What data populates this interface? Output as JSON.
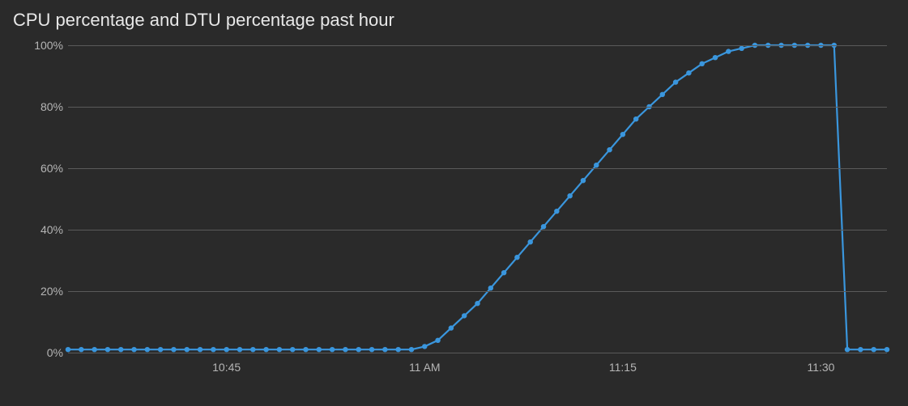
{
  "title": "CPU percentage and DTU percentage past hour",
  "colors": {
    "series": "#3a96dd",
    "grid": "#5a5a5a",
    "text": "#b5b5b5",
    "title": "#e8e8e8",
    "bg": "#2a2a2a"
  },
  "y_ticks": [
    {
      "label": "100%",
      "value": 100
    },
    {
      "label": "80%",
      "value": 80
    },
    {
      "label": "60%",
      "value": 60
    },
    {
      "label": "40%",
      "value": 40
    },
    {
      "label": "20%",
      "value": 20
    },
    {
      "label": "0%",
      "value": 0
    }
  ],
  "x_ticks": [
    {
      "label": "10:45",
      "minute": 45
    },
    {
      "label": "11 AM",
      "minute": 60
    },
    {
      "label": "11:15",
      "minute": 75
    },
    {
      "label": "11:30",
      "minute": 90
    }
  ],
  "chart_data": {
    "type": "line",
    "title": "CPU percentage and DTU percentage past hour",
    "xlabel": "",
    "ylabel": "",
    "ylim": [
      0,
      100
    ],
    "xrange_minutes": [
      33,
      95
    ],
    "x": [
      33,
      34,
      35,
      36,
      37,
      38,
      39,
      40,
      41,
      42,
      43,
      44,
      45,
      46,
      47,
      48,
      49,
      50,
      51,
      52,
      53,
      54,
      55,
      56,
      57,
      58,
      59,
      60,
      61,
      62,
      63,
      64,
      65,
      66,
      67,
      68,
      69,
      70,
      71,
      72,
      73,
      74,
      75,
      76,
      77,
      78,
      79,
      80,
      81,
      82,
      83,
      84,
      85,
      86,
      87,
      88,
      89,
      90,
      91,
      92,
      93,
      94,
      95
    ],
    "series": [
      {
        "name": "CPU / DTU percentage",
        "values": [
          1,
          1,
          1,
          1,
          1,
          1,
          1,
          1,
          1,
          1,
          1,
          1,
          1,
          1,
          1,
          1,
          1,
          1,
          1,
          1,
          1,
          1,
          1,
          1,
          1,
          1,
          1,
          2,
          4,
          8,
          12,
          16,
          21,
          26,
          31,
          36,
          41,
          46,
          51,
          56,
          61,
          66,
          71,
          76,
          80,
          84,
          88,
          91,
          94,
          96,
          98,
          99,
          100,
          100,
          100,
          100,
          100,
          100,
          100,
          1,
          1,
          1,
          1
        ]
      }
    ]
  }
}
